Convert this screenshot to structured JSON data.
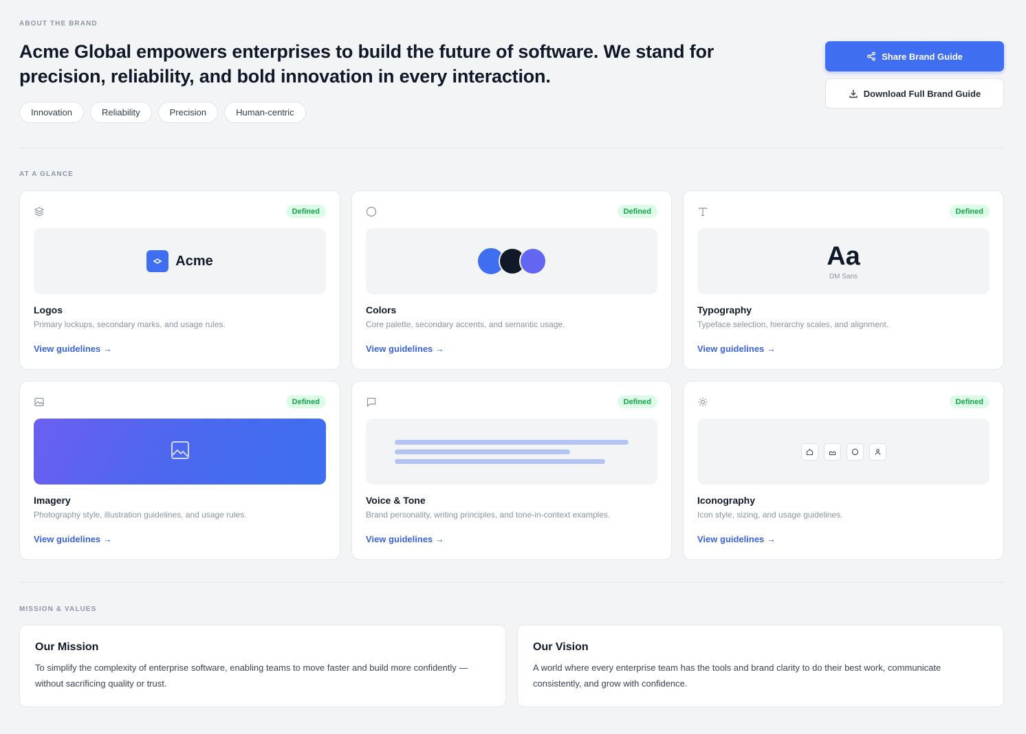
{
  "header": {
    "eyebrow": "ABOUT THE BRAND",
    "headline": "Acme Global empowers enterprises to build the future of software. We stand for precision, reliability, and bold innovation in every interaction.",
    "tags": [
      "Innovation",
      "Reliability",
      "Precision",
      "Human-centric"
    ],
    "share_button": "Share Brand Guide",
    "download_button": "Download Full Brand Guide"
  },
  "glance": {
    "eyebrow": "AT A GLANCE",
    "cards": [
      {
        "title": "Logos",
        "description": "Primary lockups, secondary marks, and usage rules.",
        "badge": "Defined",
        "link": "View guidelines →",
        "icon": "layers-icon",
        "preview_text": "Acme"
      },
      {
        "title": "Colors",
        "description": "Core palette, secondary accents, and semantic usage.",
        "badge": "Defined",
        "link": "View guidelines →",
        "icon": "circle-icon",
        "swatches": [
          "#3f6ff0",
          "#111827",
          "#6366f1"
        ]
      },
      {
        "title": "Typography",
        "description": "Typeface selection, hierarchy scales, and alignment.",
        "badge": "Defined",
        "link": "View guidelines →",
        "icon": "type-icon",
        "preview_text": "Aa",
        "font_name": "DM Sans"
      },
      {
        "title": "Imagery",
        "description": "Photography style, illustration guidelines, and usage rules.",
        "badge": "Defined",
        "link": "View guidelines →",
        "icon": "image-icon"
      },
      {
        "title": "Voice & Tone",
        "description": "Brand personality, writing principles, and tone-in-context examples.",
        "badge": "Defined",
        "link": "View guidelines →",
        "icon": "message-icon"
      },
      {
        "title": "Iconography",
        "description": "Icon style, sizing, and usage guidelines.",
        "badge": "Defined",
        "link": "View guidelines →",
        "icon": "sun-icon"
      }
    ]
  },
  "mission_values": {
    "eyebrow": "MISSION & VALUES",
    "mission": {
      "title": "Our Mission",
      "body": "To simplify the complexity of enterprise software, enabling teams to move faster and build more confidently — without sacrificing quality or trust."
    },
    "vision": {
      "title": "Our Vision",
      "body": "A world where every enterprise team has the tools and brand clarity to do their best work, communicate consistently, and grow with confidence."
    }
  },
  "colors": {
    "accent": "#3f6ff0",
    "badge_bg": "#dcfce7",
    "badge_text": "#16a34a",
    "link": "#3a63d8"
  }
}
